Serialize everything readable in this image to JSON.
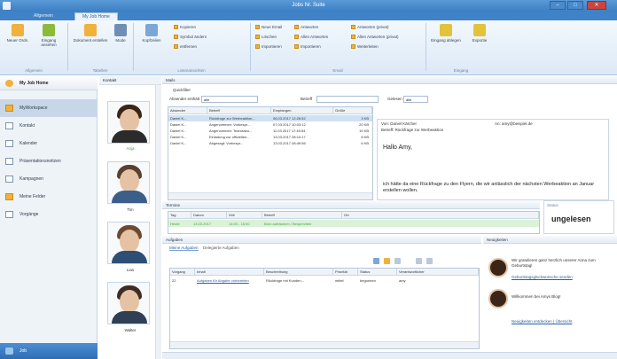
{
  "window": {
    "title": "Jobs Nr. Suite"
  },
  "tabs": [
    {
      "label": "Allgemein"
    },
    {
      "label": "My Job Home"
    }
  ],
  "ribbon": {
    "buttons": [
      {
        "label": "Neuer Ordn.",
        "color": "#f0b23a"
      },
      {
        "label": "Eingang ansehen",
        "color": "#8cbb3a"
      },
      {
        "label": "Dokument erstellen",
        "color": "#f0b23a"
      },
      {
        "label": "Mode",
        "color": "#6e8fb3"
      },
      {
        "label": "Kopfzeilen",
        "color": "#7aa7d8"
      }
    ],
    "small_items": [
      "Kopieren",
      "Symbol ändern",
      "entfernen",
      "Neue Email",
      "Löschen",
      "Importieren",
      "Antworten",
      "Allen Antworten",
      "Importieren",
      "Antworten (privat)",
      "Allen Antworten (privat)",
      "Weiterleiten"
    ],
    "right_buttons": [
      {
        "label": "Eingang ablegen",
        "color": "#e2c33a"
      },
      {
        "label": "Exportie",
        "color": "#e2c33a"
      }
    ],
    "groups": [
      "Allgemein",
      "Tabellen",
      "Listenansichten",
      "Email",
      "Eingang"
    ]
  },
  "sidebar": {
    "home_label": "My Job Home",
    "items": [
      "MyWorkspace",
      "Kontakt",
      "Kalender",
      "Präsentationsnotizen",
      "Kampagnen",
      "Meine Felder",
      "Vorgänge"
    ],
    "bottom_label": "Job"
  },
  "contacts": {
    "header": "Kontakt",
    "people": [
      {
        "name": "Anja",
        "hair": "#3a2518",
        "shirt": "#2b2b2b",
        "status": "online"
      },
      {
        "name": "Tim",
        "hair": "#5a4030",
        "shirt": "#3b5f88",
        "status": "offline"
      },
      {
        "name": "Lias",
        "hair": "#6b4a30",
        "shirt": "#2d4f75",
        "status": "offline"
      },
      {
        "name": "Walter",
        "hair": "#3d2d22",
        "shirt": "#2f3f55",
        "status": "offline"
      }
    ]
  },
  "mail": {
    "header": "Mails",
    "filter_label": "Quickfilter",
    "account_label": "Absender enthält",
    "account_value": "alle",
    "subject_label": "Betreff",
    "status_label": "Gelesen",
    "status_value": "alle",
    "columns": [
      "Absender",
      "Betreff",
      "Empfangen",
      "Größe"
    ],
    "rows": [
      {
        "sender": "Daniel K...",
        "subject": "Rückfrage zur Werbeaktion...",
        "date": "06.03.2017 12:26:52",
        "size": "3 KB",
        "selected": true
      },
      {
        "sender": "Daniel K...",
        "subject": "Angenommen: Vorbespr...",
        "date": "07.03.2017 10:03:12",
        "size": "20 KB",
        "selected": false
      },
      {
        "sender": "Daniel K...",
        "subject": "Angenommen: Teamsitzu...",
        "date": "11.03.2017 17:45:54",
        "size": "15 KB",
        "selected": false
      },
      {
        "sender": "Daniel K...",
        "subject": "Einladung zur offiziellen...",
        "date": "13.03.2017 08:10:17",
        "size": "8 KB",
        "selected": false
      },
      {
        "sender": "Daniel K...",
        "subject": "Abgesagt: Vorbespr...",
        "date": "13.03.2017 08:49:56",
        "size": "6 KB",
        "selected": false
      }
    ],
    "preview_from": "Von: Daniel Kärcher",
    "preview_to": "An: amy@beispiel.de",
    "preview_subject": "Betreff: Rückfrage zur Werbeaktion",
    "greeting": "Hallo Amy,",
    "body": "ich hätte da eine Rückfrage zu den Flyern, die wir anlässlich der nächsten Werbeaktion an Januar erstellen wollen."
  },
  "status_box": {
    "label": "Status",
    "value": "ungelesen"
  },
  "events": {
    "header": "Termine",
    "columns": [
      "Tag",
      "Datum",
      "Zeit",
      "Betreff",
      "Ort"
    ],
    "row": {
      "day": "Heute",
      "date": "13.03.2017",
      "time": "14:00 - 15:00",
      "subject": "Büro aufräumen / Besprechen",
      "place": ""
    }
  },
  "tasks": {
    "header": "Aufgaben",
    "tab_mine": "Meine Aufgaben",
    "tab_delegated": "Delegierte Aufgaben",
    "columns": [
      "Vorgang",
      "Inhalt",
      "Beschreibung",
      "Priorität",
      "Status",
      "Verantwortlicher"
    ],
    "row": {
      "id": "22",
      "content": "Aufgaben für Abgabe vorbereiten",
      "desc": "Rückfrage mit Kunden...",
      "prio": "mittel",
      "status": "begonnen",
      "owner": "amy"
    }
  },
  "feed": {
    "header": "Neuigkeiten",
    "items": [
      {
        "text": "Wir gratulieren ganz herzlich unserer Anna zum Geburtstag!",
        "link": "Geburtstagsglückwünsche senden"
      },
      {
        "text": "Willkommen bei Amys Blog!",
        "link": "Neuigkeiten entdecken | Übersicht"
      }
    ]
  }
}
